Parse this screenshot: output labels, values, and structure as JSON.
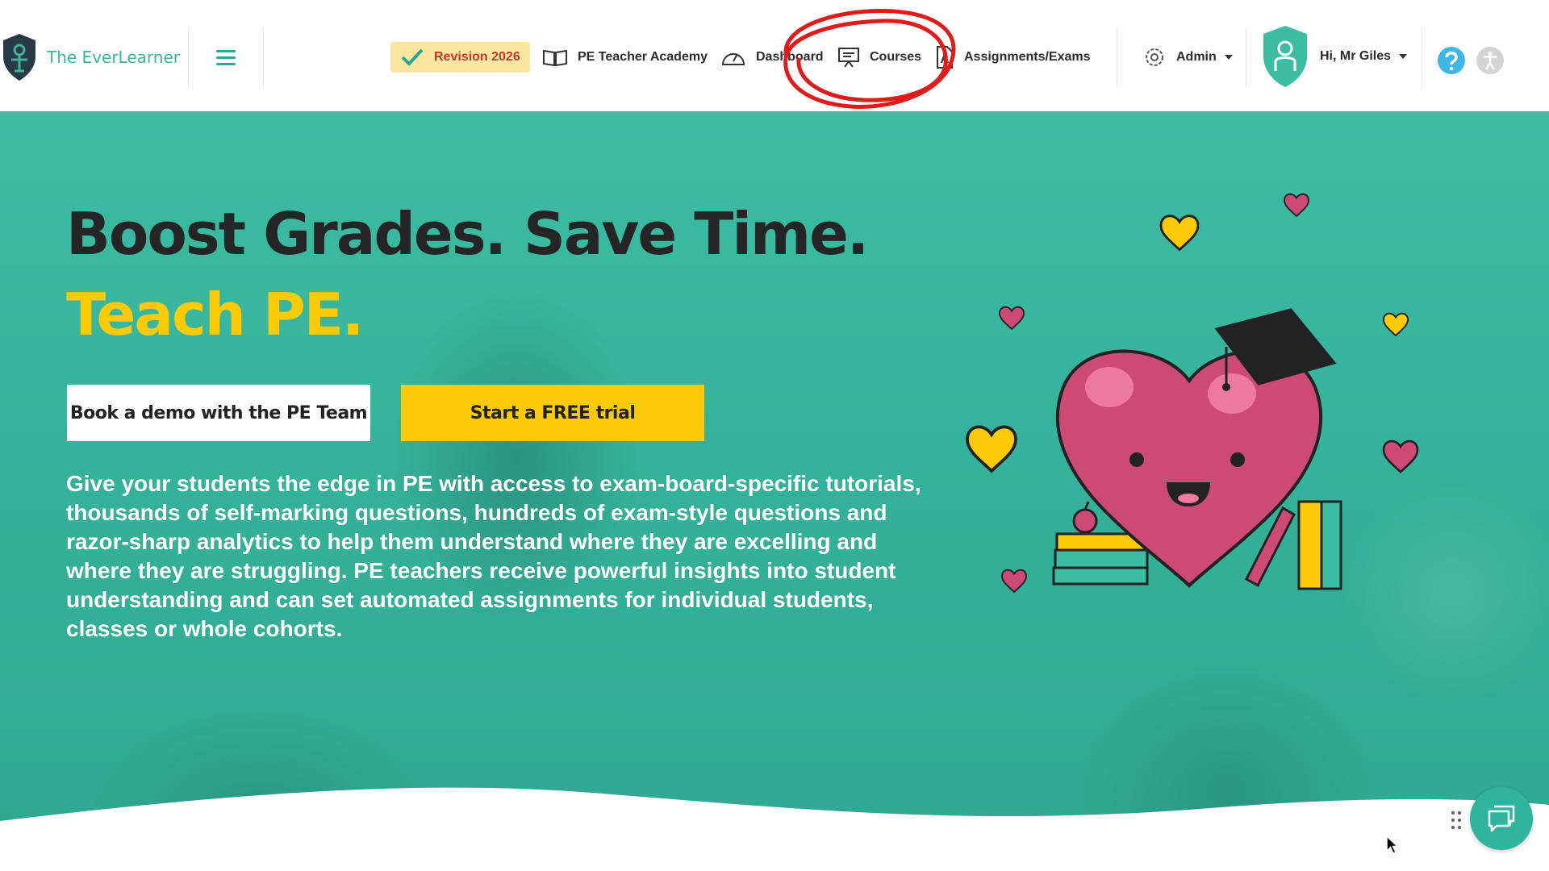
{
  "brand": {
    "name": "The EverLearner"
  },
  "nav": {
    "revision_label": "Revision 2026",
    "academy_label": "PE Teacher Academy",
    "dashboard_label": "Dashboard",
    "courses_label": "Courses",
    "assignments_label": "Assignments/Exams",
    "admin_label": "Admin",
    "greeting": "Hi, Mr Giles"
  },
  "hero": {
    "headline": "Boost Grades. Save Time.",
    "subhead": "Teach PE.",
    "demo_button": "Book a demo with the PE Team",
    "trial_button": "Start a FREE trial",
    "description": "Give your students the edge in PE with access to exam-board-specific tutorials, thousands of self-marking questions, hundreds of exam-style questions and razor-sharp analytics to help them understand where they are excelling and where they are struggling. PE teachers receive powerful insights into student understanding and can set automated assignments for individual students, classes or whole cohorts."
  },
  "icons": {
    "logo": "everlearner-shield-logo",
    "menu": "hamburger-menu-icon",
    "revision": "checkmark-icon",
    "academy": "open-book-icon",
    "dashboard": "speedometer-icon",
    "courses": "presentation-board-icon",
    "assignments": "document-icon",
    "admin": "gear-icon",
    "avatar": "teacher-shield-avatar",
    "help": "question-mark-icon",
    "accessibility": "accessibility-person-icon",
    "chat": "chat-bubbles-icon"
  },
  "colors": {
    "teal": "#3dbca4",
    "yellow": "#fcca06",
    "revision_bg": "#fde7a0",
    "revision_text": "#c0392b",
    "heart_pink": "#cc4a73",
    "annotation_red": "#e01b1b"
  }
}
